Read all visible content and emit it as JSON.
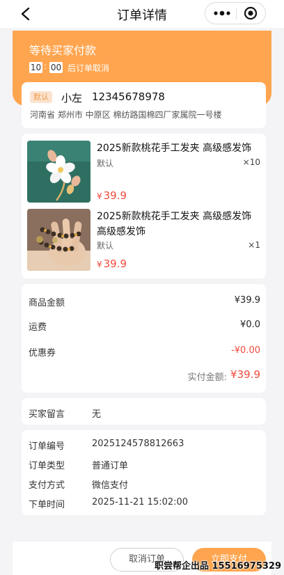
{
  "nav": {
    "title": "订单详情"
  },
  "status": {
    "title": "等待买家付款",
    "countdown_min": "10",
    "countdown_sec": "00",
    "countdown_tail": "后订单取消"
  },
  "address": {
    "tag": "默认",
    "name": "小左",
    "phone": "12345678978",
    "detail": "河南省  郑州市  中原区  棉纺路国棉四厂家属院一号楼"
  },
  "goods": [
    {
      "name": "2025新款桃花手工发夹 高级感发饰",
      "spec": "默认",
      "qty": "×10",
      "currency": "¥",
      "price": "39.9"
    },
    {
      "name": "2025新款桃花手工发夹 高级感发饰高级感发饰",
      "spec": "默认",
      "qty": "×1",
      "currency": "¥",
      "price": "39.9"
    }
  ],
  "amounts": {
    "goods_label": "商品金额",
    "goods_value": "¥39.9",
    "shipping_label": "运费",
    "shipping_value": "¥0.0",
    "coupon_label": "优惠券",
    "coupon_value": "-¥0.00",
    "paid_label": "实付金额:",
    "paid_value": "¥39.9"
  },
  "message": {
    "label": "买家留言",
    "value": "无"
  },
  "info": {
    "order_no_label": "订单编号",
    "order_no": "2025124578812663",
    "order_type_label": "订单类型",
    "order_type": "普通订单",
    "pay_method_label": "支付方式",
    "pay_method": "微信支付",
    "order_time_label": "下单时间",
    "order_time": "2025-11-21 15:02:00"
  },
  "footer": {
    "cancel_label": "取消订单",
    "pay_label": "立即支付"
  },
  "watermark": "职尝帮企出品  15516975329",
  "colors": {
    "accent": "#ffa54f",
    "price_red": "#f24a3c",
    "background": "#f4f4f6"
  },
  "icons": {
    "back": "chevron-left-icon",
    "more": "more-dots-icon",
    "close": "target-circle-icon"
  }
}
